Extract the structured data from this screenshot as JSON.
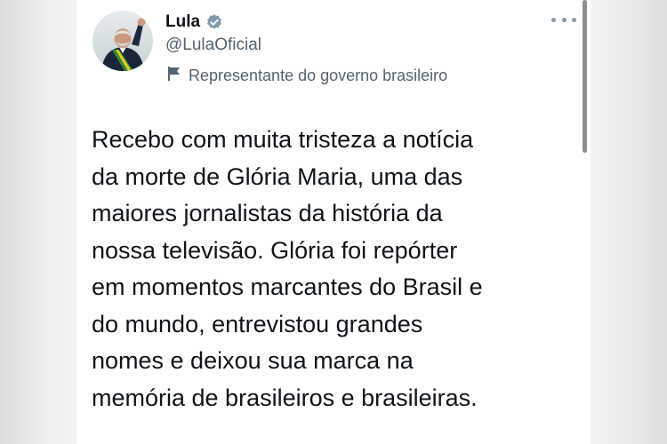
{
  "tweet": {
    "author": {
      "name": "Lula",
      "handle": "@LulaOficial",
      "verified_icon": "verified-badge-icon",
      "verified_color": "#829aab",
      "avatar": "avatar-photo"
    },
    "account_label": {
      "icon": "flag-icon",
      "text": "Representante do governo brasileiro"
    },
    "more_icon": "more-dots-icon",
    "text_lines": [
      "Recebo com muita tristeza a notícia",
      "da morte de Glória Maria, uma das",
      "maiores jornalistas da história da",
      "nossa televisão. Glória foi repórter",
      "em momentos marcantes do Brasil e",
      "do mundo, entrevistou grandes",
      "nomes e deixou sua marca na",
      "memória de brasileiros e brasileiras."
    ]
  },
  "colors": {
    "text_primary": "#0f1419",
    "text_secondary": "#536471",
    "background": "#ffffff"
  }
}
